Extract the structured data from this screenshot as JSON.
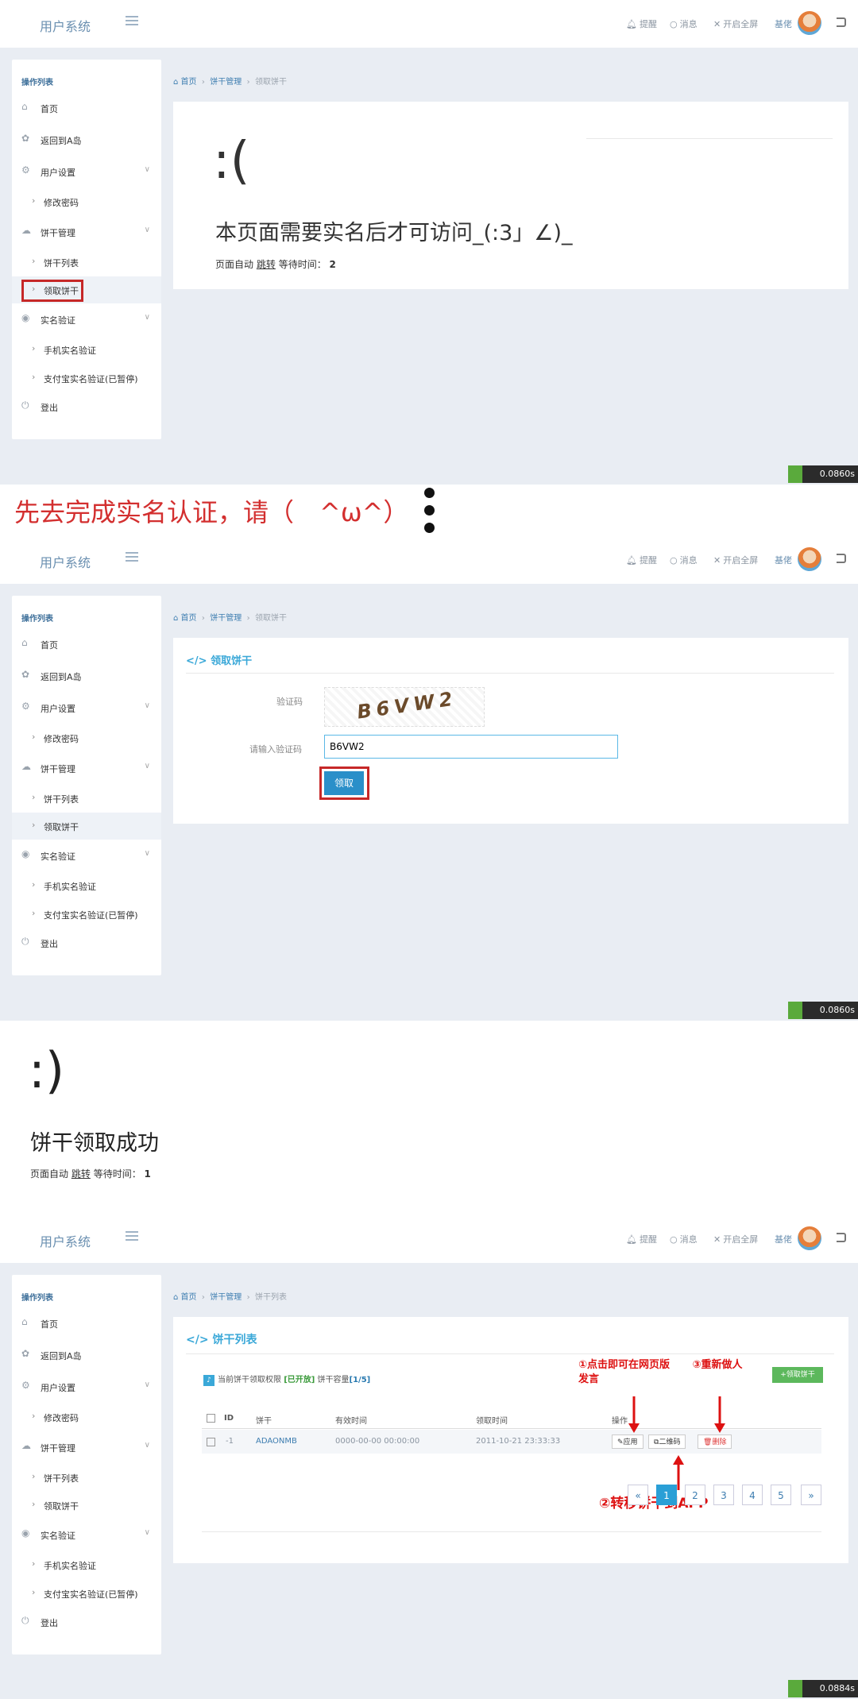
{
  "app": {
    "brand": "用户系统",
    "nav_right": [
      "提醒",
      "消息",
      "开启全屏",
      "基佬"
    ]
  },
  "sidebar": {
    "title": "操作列表",
    "items": [
      {
        "label": "首页"
      },
      {
        "label": "返回到A岛"
      },
      {
        "label": "用户设置"
      },
      {
        "label": "修改密码"
      },
      {
        "label": "饼干管理"
      },
      {
        "label": "饼干列表"
      },
      {
        "label": "领取饼干"
      },
      {
        "label": "实名验证"
      },
      {
        "label": "手机实名验证"
      },
      {
        "label": "支付宝实名验证(已暂停)"
      },
      {
        "label": "登出"
      }
    ]
  },
  "panel1": {
    "crumbs": [
      "首页",
      "饼干管理",
      "领取饼干"
    ],
    "face": ":(",
    "message": "本页面需要实名后才可访问_(:3」∠)_",
    "redirect_prefix": "页面自动",
    "redirect_link": "跳转",
    "redirect_wait": "等待时间：",
    "redirect_seconds": "2",
    "timer": "0.0860s"
  },
  "caption": {
    "text": "先去完成实名认证，请（　^ω^）"
  },
  "panel2": {
    "crumbs": [
      "首页",
      "饼干管理",
      "领取饼干"
    ],
    "card_title": "领取饼干",
    "captcha_label": "验证码",
    "captcha_text": "B6VW2",
    "input_label": "请输入验证码",
    "input_value": "B6VW2",
    "submit": "领取",
    "timer": "0.0860s"
  },
  "panel3": {
    "face": ":)",
    "message": "饼干领取成功",
    "redirect_prefix": "页面自动",
    "redirect_link": "跳转",
    "redirect_wait": "等待时间：",
    "redirect_seconds": "1"
  },
  "panel4": {
    "crumbs": [
      "首页",
      "饼干管理",
      "饼干列表"
    ],
    "card_title": "饼干列表",
    "notice_prefix": "当前饼干领取权限",
    "notice_status": "[已开放]",
    "notice_mid": "饼干容量",
    "notice_capacity": "[1/5]",
    "add_button": "+领取饼干",
    "columns": [
      "ID",
      "饼干",
      "有效时间",
      "领取时间",
      "操作"
    ],
    "row": {
      "id": "-1",
      "cookie": "ADAONMB",
      "valid": "0000-00-00 00:00:00",
      "claimed": "2011-10-21 23:33:33"
    },
    "actions": [
      "应用",
      "二维码",
      "删除"
    ],
    "pages": [
      "«",
      "1",
      "2",
      "3",
      "4",
      "5",
      "»"
    ],
    "current_page": 1,
    "annot1": "①点击即可在网页版发言",
    "annot2": "②转移饼干到APP",
    "annot3": "③重新做人",
    "timer": "0.0884s"
  },
  "colors": {
    "brand": "#6a8fb0",
    "accent": "#3aa8d8",
    "alert": "#c62828",
    "success": "#5cb85c"
  }
}
